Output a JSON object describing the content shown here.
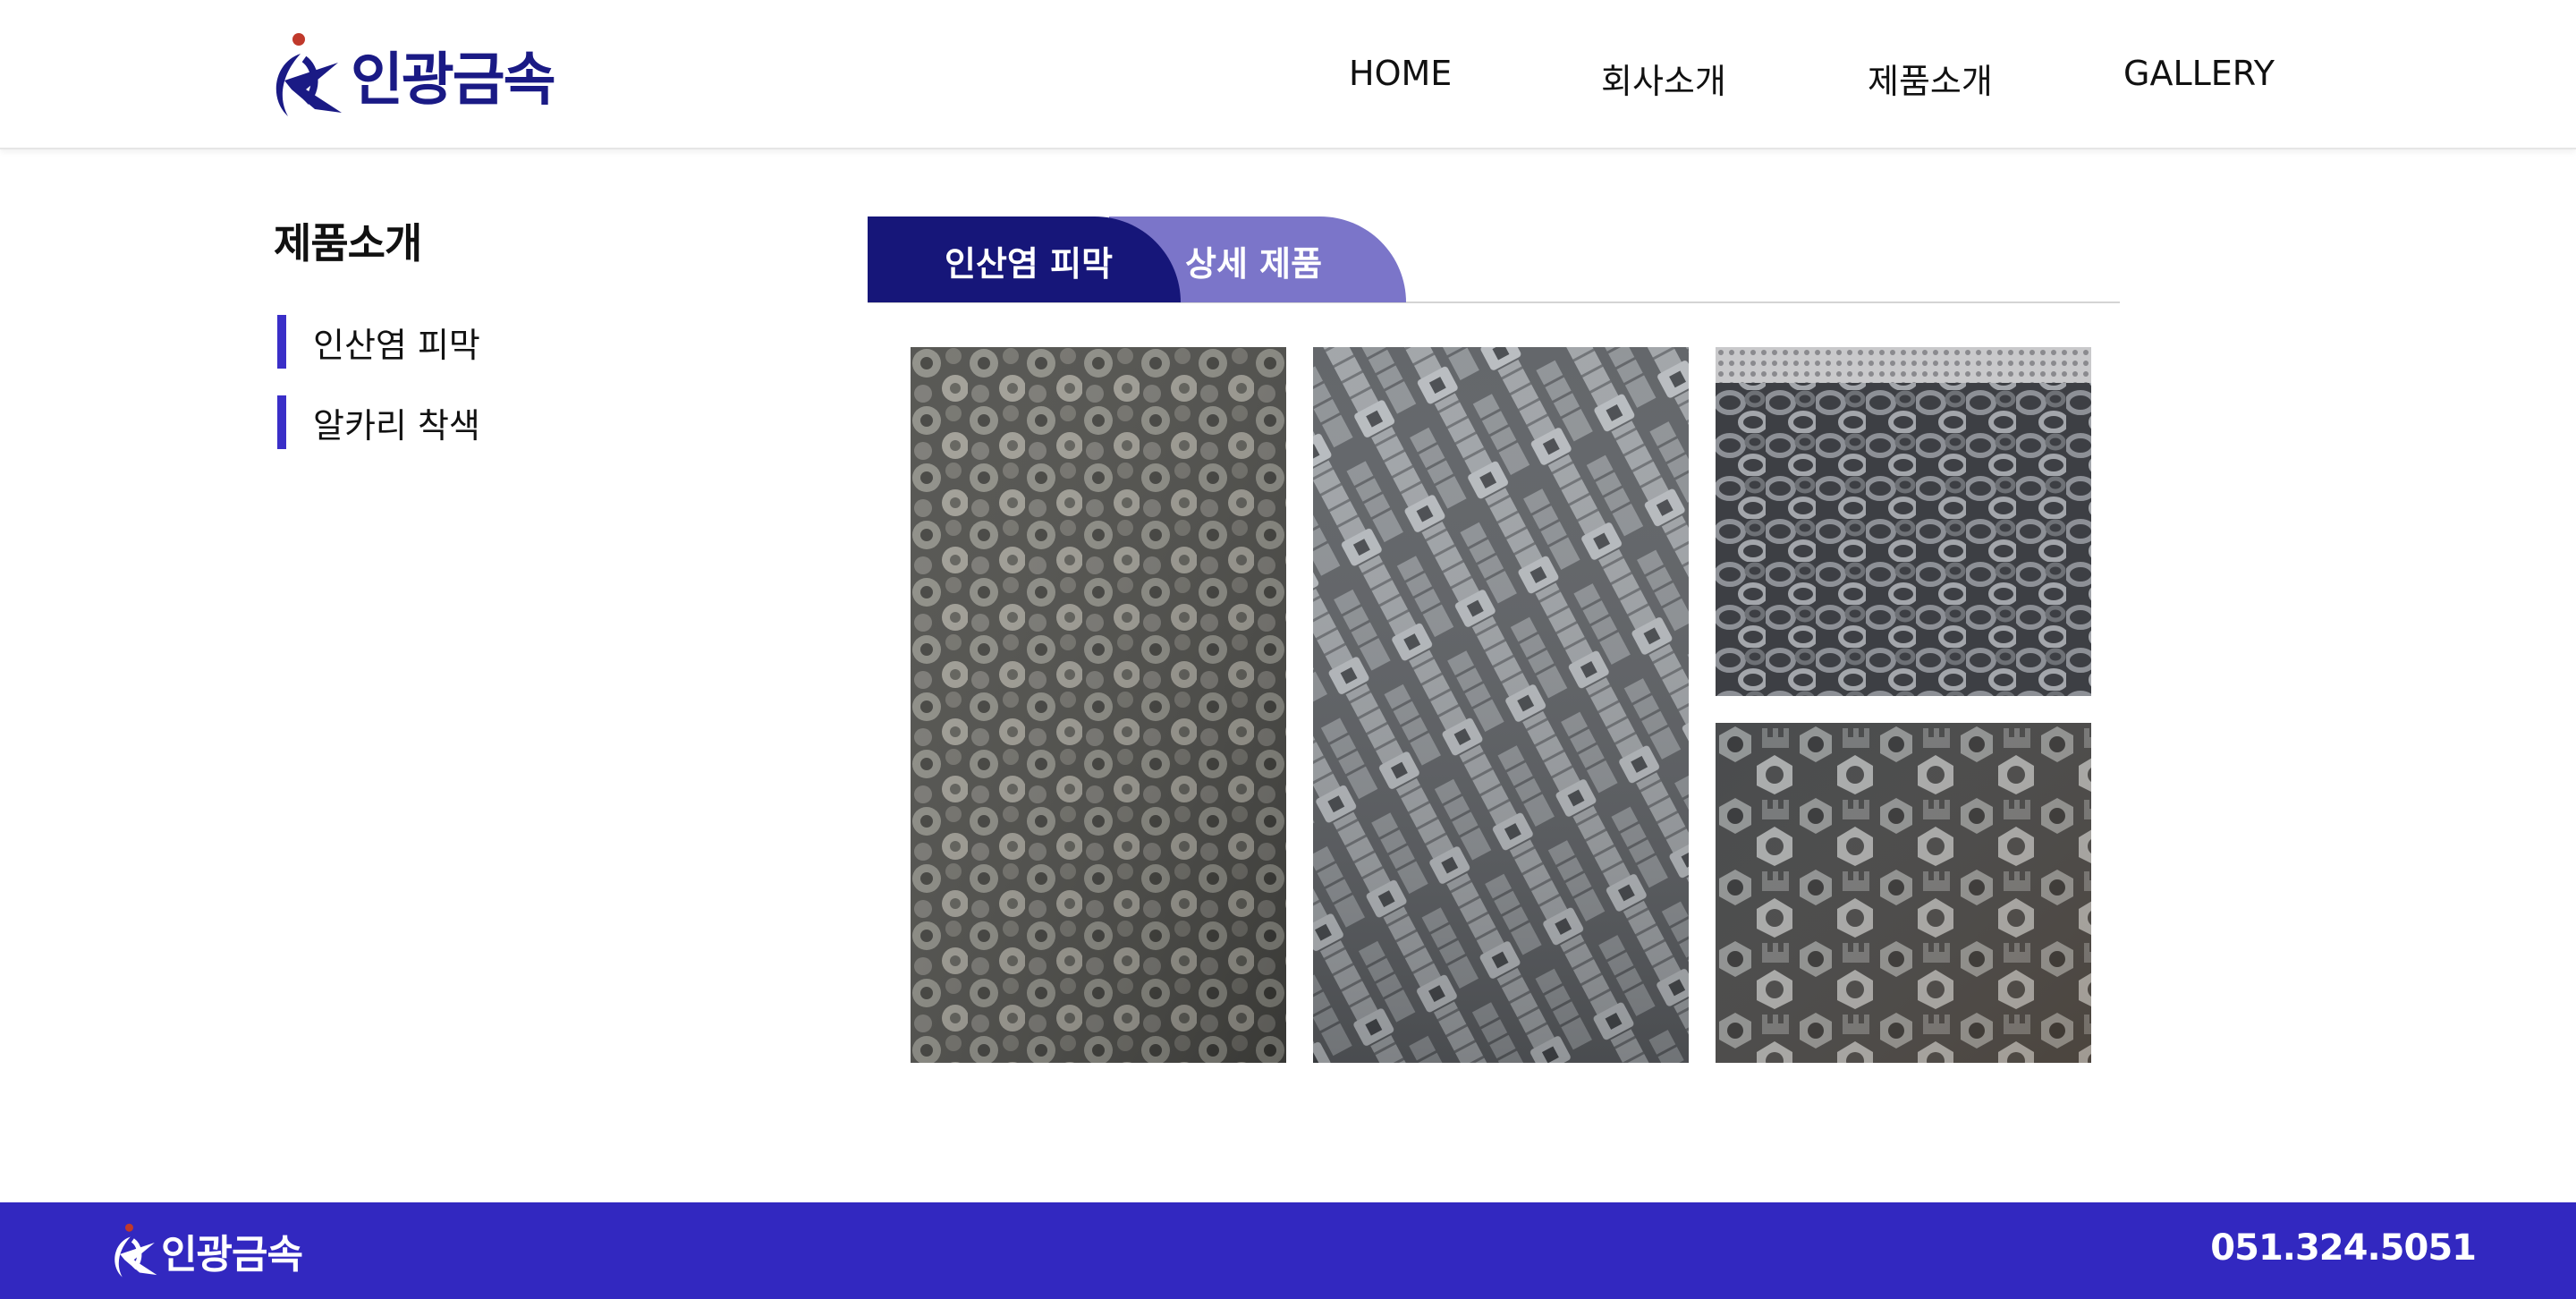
{
  "brand": {
    "name": "인광금속",
    "primary_color": "#1a1a85",
    "accent_dot_color": "#c0392b"
  },
  "nav": {
    "items": [
      {
        "label": "HOME"
      },
      {
        "label": "회사소개"
      },
      {
        "label": "제품소개"
      },
      {
        "label": "GALLERY"
      }
    ]
  },
  "sidebar": {
    "title": "제품소개",
    "items": [
      {
        "label": "인산염 피막"
      },
      {
        "label": "알카리 착색"
      }
    ]
  },
  "tabs": {
    "active": {
      "label": "인산염 피막",
      "color": "#161679"
    },
    "inactive": {
      "label": "상세 제품",
      "color": "#7b75c9"
    }
  },
  "gallery": {
    "photos": [
      {
        "subject": "flange-bolts-photo"
      },
      {
        "subject": "socket-head-cap-screws-photo"
      },
      {
        "subject": "ring-nuts-photo"
      },
      {
        "subject": "castle-nuts-photo"
      }
    ]
  },
  "footer": {
    "brand": "인광금속",
    "phone": "051.324.5051",
    "background": "#3228c0"
  }
}
